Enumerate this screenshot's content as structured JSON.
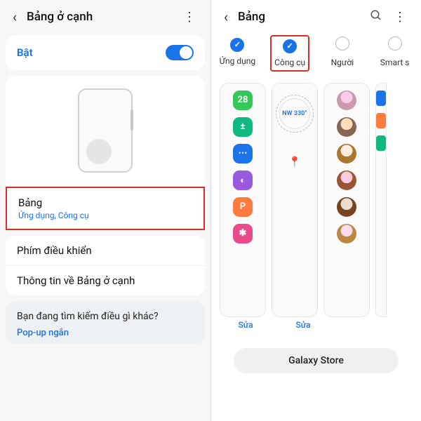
{
  "left": {
    "header_title": "Bảng ở cạnh",
    "toggle_label": "Bật",
    "rows": [
      {
        "title": "Bảng",
        "sub": "Ứng dụng, Công cụ"
      },
      {
        "title": "Phím điều khiển"
      },
      {
        "title": "Thông tin về Bảng ở cạnh"
      }
    ],
    "footer_q": "Bạn đang tìm kiếm điều gì khác?",
    "footer_link": "Pop-up ngắn"
  },
  "right": {
    "header_title": "Bảng",
    "tabs": [
      "Ứng dụng",
      "Công cụ",
      "Người",
      "Smart s"
    ],
    "compass_value": "330",
    "compass_dir": "NW",
    "edit_label": "Sửa",
    "store_btn": "Galaxy Store",
    "app_icons": [
      "calendar-icon",
      "calculator-icon",
      "messages-icon",
      "bixby-icon",
      "powerpoint-icon",
      "gallery-icon"
    ],
    "calendar_day": "28"
  }
}
